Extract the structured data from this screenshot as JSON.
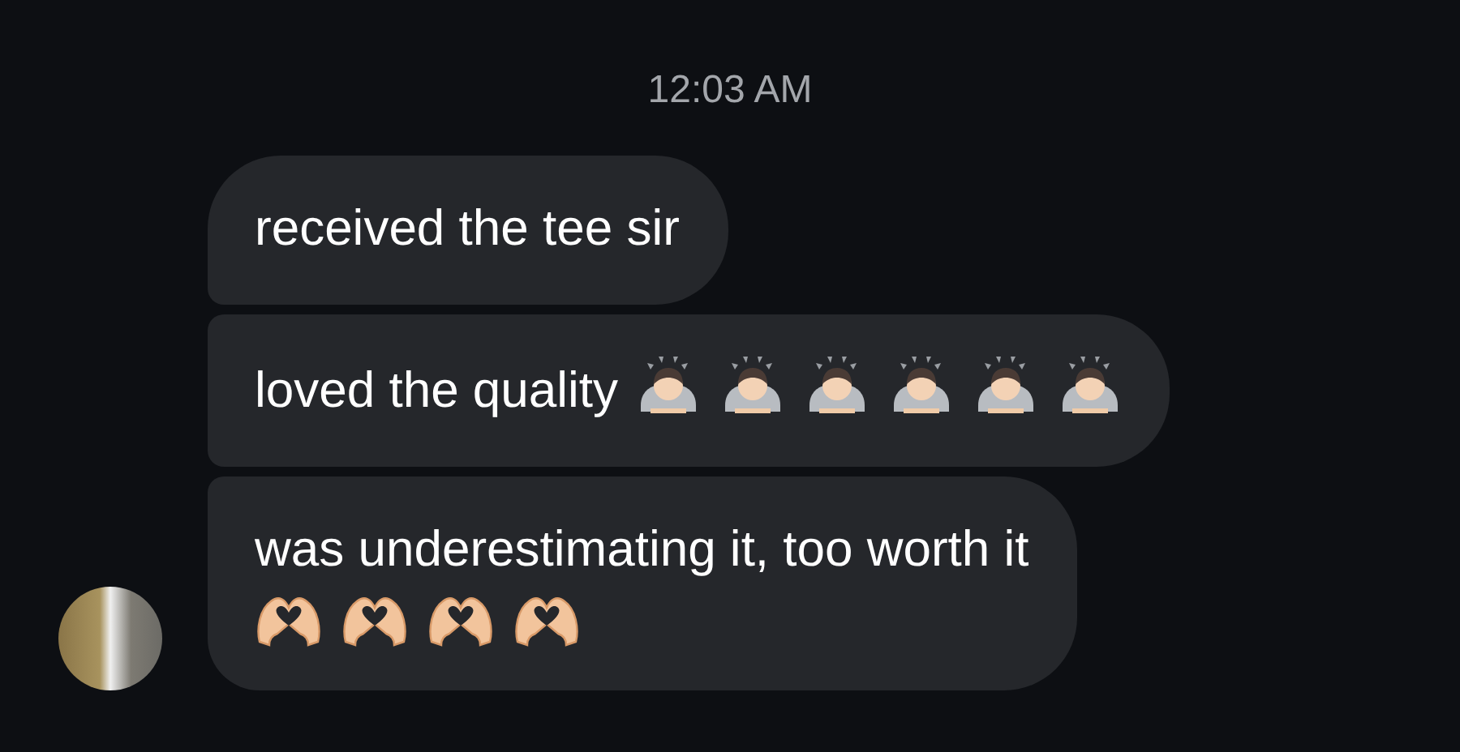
{
  "timestamp": "12:03 AM",
  "messages": [
    {
      "text": "received the tee sir",
      "show_avatar": false
    },
    {
      "text": "loved the quality",
      "emojis": [
        {
          "kind": "bow"
        },
        {
          "kind": "bow"
        },
        {
          "kind": "bow"
        },
        {
          "kind": "bow"
        },
        {
          "kind": "bow"
        },
        {
          "kind": "bow"
        }
      ],
      "show_avatar": false
    },
    {
      "text": "was underestimating it, too worth it",
      "emojis": [
        {
          "kind": "heart_hands"
        },
        {
          "kind": "heart_hands"
        },
        {
          "kind": "heart_hands"
        },
        {
          "kind": "heart_hands"
        }
      ],
      "show_avatar": true
    }
  ]
}
